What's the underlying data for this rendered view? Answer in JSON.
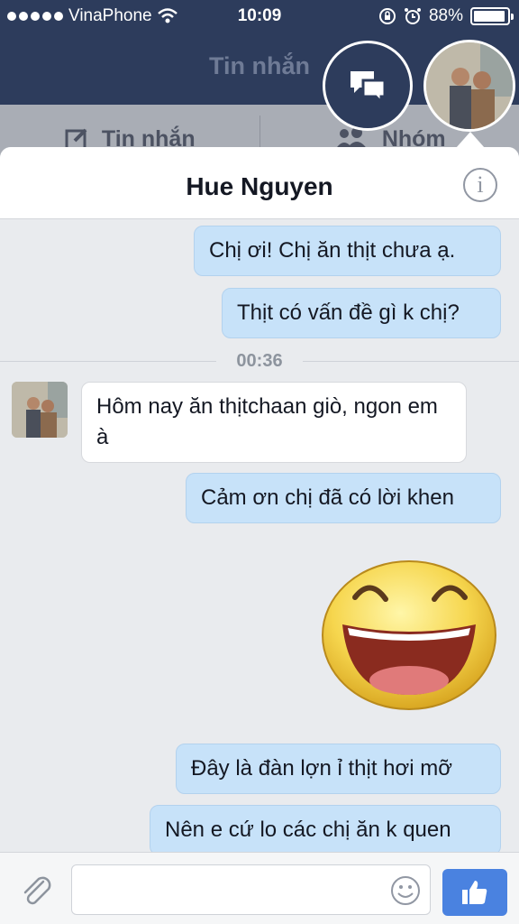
{
  "status_bar": {
    "carrier": "VinaPhone",
    "time": "10:09",
    "battery": "88%"
  },
  "header": {
    "title": "Tin nhắn",
    "tabs": [
      {
        "label": "Tin nhắn",
        "icon": "compose-icon"
      },
      {
        "label": "Nhóm",
        "icon": "group-icon"
      }
    ]
  },
  "conversation": {
    "name": "Hue Nguyen",
    "timestamp": "00:36",
    "messages": [
      {
        "direction": "out",
        "text": "Chị ơi! Chị ăn thịt chưa ạ."
      },
      {
        "direction": "out",
        "text": "Thịt có vấn đề gì k chị?"
      },
      {
        "direction": "in",
        "text": "Hôm nay ăn thịtchaan giò, ngon em à"
      },
      {
        "direction": "out",
        "text": "Cảm ơn chị đã có lời khen"
      },
      {
        "direction": "out",
        "type": "sticker",
        "sticker": "laughing-face"
      },
      {
        "direction": "out",
        "text": "Đây là đàn lợn ỉ thịt hơi mỡ"
      },
      {
        "direction": "out",
        "text": "Nên e cứ lo các chị ăn k quen"
      }
    ]
  },
  "composer": {
    "placeholder": "",
    "send_icon": "thumbs-up-icon"
  },
  "colors": {
    "header_bg": "#2d3c5c",
    "outgoing_bubble": "#c7e2f9",
    "incoming_bubble": "#ffffff",
    "like_button": "#4a82e0"
  }
}
